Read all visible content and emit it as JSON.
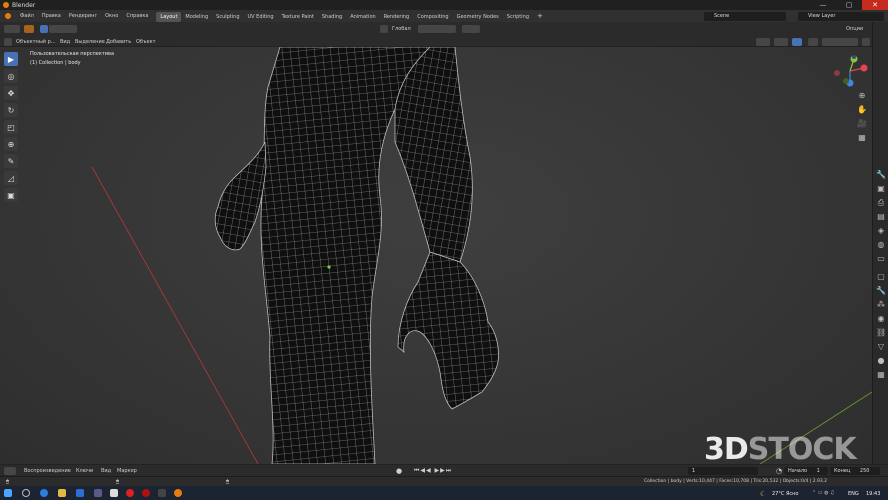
{
  "window": {
    "title": "Blender",
    "controls": [
      "—",
      "▢",
      "✕"
    ]
  },
  "menubar": {
    "items": [
      "Файл",
      "Правка",
      "Рендеринг",
      "Окно",
      "Справка"
    ],
    "workspaces": [
      "Layout",
      "Modeling",
      "Sculpting",
      "UV Editing",
      "Texture Paint",
      "Shading",
      "Animation",
      "Rendering",
      "Compositing",
      "Geometry Nodes",
      "Scripting"
    ],
    "active_workspace": "Layout",
    "add_tab": "+",
    "scene": "Scene",
    "view_layer": "View Layer"
  },
  "tool_header": {
    "transform_orientation": "Глобал",
    "options": "Опции"
  },
  "viewport_header": {
    "mode": "Объектный р...",
    "menu": [
      "Вид",
      "Выделение",
      "Добавить",
      "Объект"
    ]
  },
  "viewport": {
    "perspective_label": "Пользовательская перспектива",
    "collection_label": "(1) Collection | body",
    "gizmo_axes": [
      "X",
      "Y",
      "Z"
    ]
  },
  "left_tools": [
    {
      "name": "select-box-tool",
      "glyph": "▶",
      "active": true
    },
    {
      "name": "cursor-tool",
      "glyph": "◎",
      "active": false
    },
    {
      "name": "move-tool",
      "glyph": "✥",
      "active": false
    },
    {
      "name": "rotate-tool",
      "glyph": "↻",
      "active": false
    },
    {
      "name": "scale-tool",
      "glyph": "◰",
      "active": false
    },
    {
      "name": "transform-tool",
      "glyph": "⊕",
      "active": false
    },
    {
      "name": "annotate-tool",
      "glyph": "✎",
      "active": false
    },
    {
      "name": "measure-tool",
      "glyph": "📐",
      "active": false
    },
    {
      "name": "add-cube-tool",
      "glyph": "▣",
      "active": false
    }
  ],
  "timeline": {
    "menu": [
      "Воспроизведение",
      "Ключи",
      "Вид",
      "Маркер"
    ],
    "current_frame": "1",
    "start_label": "Начало",
    "start": "1",
    "end_label": "Конец",
    "end": "250"
  },
  "statusbar": {
    "text": "Collection | body | Verts:10,447 | Faces:10,708 | Tris:20,532 | Objects:0/4 | 2.93.2"
  },
  "taskbar": {
    "weather": "27°C Ясно",
    "language": "ENG",
    "time": "19:43"
  },
  "watermark": {
    "prefix": "3D",
    "rest": "STOCK"
  },
  "colors": {
    "accent": "#4772b3",
    "brand": "#e87d0d",
    "axis_x": "#e8434f",
    "axis_y": "#8ac33f",
    "axis_z": "#3f86e0"
  }
}
